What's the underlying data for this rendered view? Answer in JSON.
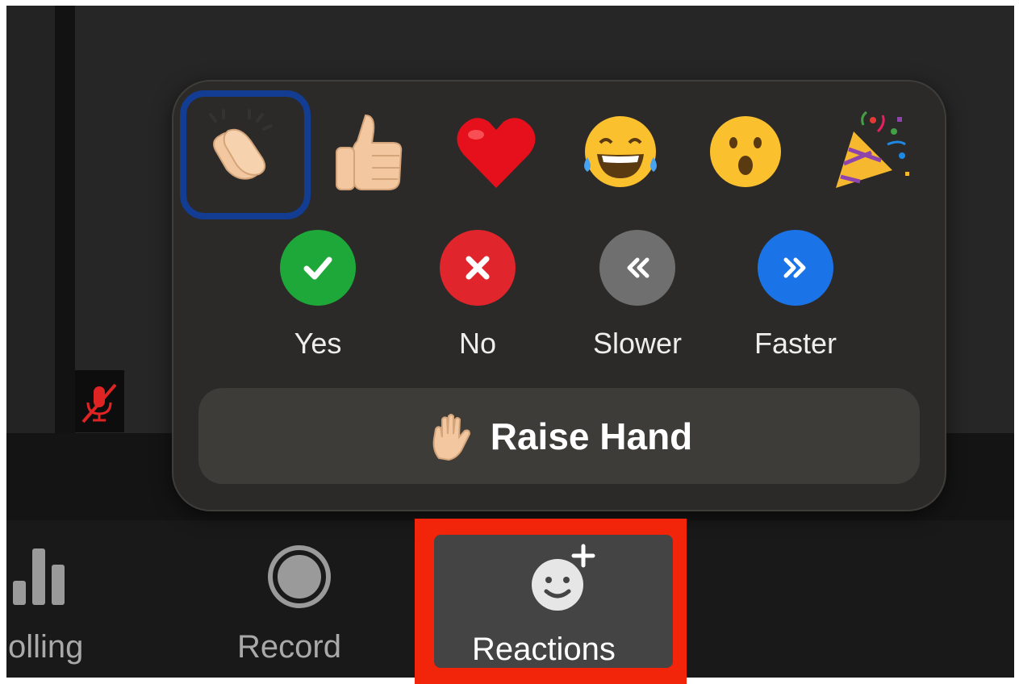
{
  "reactions_popup": {
    "emoji_reactions": [
      {
        "name": "clapping-hands",
        "glyph": "👏"
      },
      {
        "name": "thumbs-up",
        "glyph": "👍"
      },
      {
        "name": "heart",
        "glyph": "❤️"
      },
      {
        "name": "tears-of-joy",
        "glyph": "😂"
      },
      {
        "name": "open-mouth",
        "glyph": "😮"
      },
      {
        "name": "party-popper",
        "glyph": "🎉"
      }
    ],
    "feedback": [
      {
        "label": "Yes",
        "icon": "check-icon",
        "color": "#1fa83a"
      },
      {
        "label": "No",
        "icon": "x-icon",
        "color": "#e0262c"
      },
      {
        "label": "Slower",
        "icon": "rewind-icon",
        "color": "#6f6f6f"
      },
      {
        "label": "Faster",
        "icon": "fast-forward-icon",
        "color": "#1a74e8"
      }
    ],
    "raise_hand": {
      "label": "Raise Hand",
      "icon": "raised-hand-icon"
    }
  },
  "toolbar": {
    "polling": {
      "label": "olling",
      "icon": "bar-chart-icon"
    },
    "record": {
      "label": "Record",
      "icon": "record-icon"
    },
    "reactions": {
      "label": "Reactions",
      "icon": "add-reaction-icon"
    }
  },
  "colors": {
    "popup_bg": "#2b2a28",
    "focus_ring": "#123d93",
    "highlight": "#f2250b",
    "muted_red": "#e02424"
  }
}
